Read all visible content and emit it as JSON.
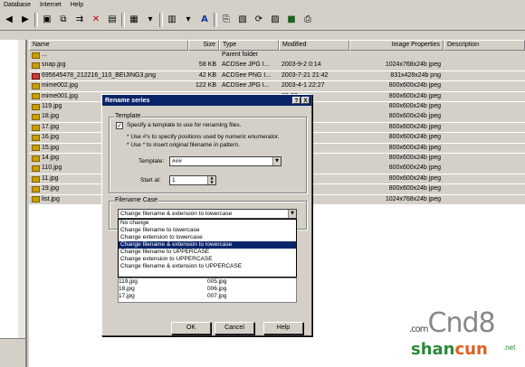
{
  "menu": [
    "Database",
    "Internet",
    "Help"
  ],
  "columns": [
    "Name",
    "Size",
    "Type",
    "Modified",
    "Image Properties",
    "Description"
  ],
  "files": [
    {
      "name": "...",
      "size": "",
      "type": "Parent folder",
      "modified": "",
      "props": "",
      "icon": "folder"
    },
    {
      "name": "snap.jpg",
      "size": "58 KB",
      "type": "ACDSee JPG I...",
      "modified": "2003-9-2 0:14",
      "props": "1024x768x24b jpeg",
      "icon": "jpg"
    },
    {
      "name": "695645478_212216_110_BEIJING3.png",
      "size": "42 KB",
      "type": "ACDSee PNG I...",
      "modified": "2003-7-21 21:42",
      "props": "831x428x24b png",
      "icon": "png"
    },
    {
      "name": "mime002.jpg",
      "size": "122 KB",
      "type": "ACDSee JPG I...",
      "modified": "2003-4-1 22:27",
      "props": "800x600x24b jpeg",
      "icon": "jpg"
    },
    {
      "name": "mime001.jpg",
      "size": "",
      "type": "",
      "modified": "22:27",
      "props": "800x600x24b jpeg",
      "icon": "jpg"
    },
    {
      "name": "119.jpg",
      "size": "",
      "type": "",
      "modified": "2:27",
      "props": "800x600x24b jpeg",
      "icon": "jpg"
    },
    {
      "name": "18.jpg",
      "size": "",
      "type": "",
      "modified": "2:27",
      "props": "800x600x24b jpeg",
      "icon": "jpg"
    },
    {
      "name": "17.jpg",
      "size": "",
      "type": "",
      "modified": "2:27",
      "props": "800x600x24b jpeg",
      "icon": "jpg"
    },
    {
      "name": "16.jpg",
      "size": "",
      "type": "",
      "modified": "2:27",
      "props": "800x600x24b jpeg",
      "icon": "jpg"
    },
    {
      "name": "15.jpg",
      "size": "",
      "type": "",
      "modified": "2:27",
      "props": "800x600x24b jpeg",
      "icon": "jpg"
    },
    {
      "name": "14.jpg",
      "size": "",
      "type": "",
      "modified": "2:27",
      "props": "800x600x24b jpeg",
      "icon": "jpg"
    },
    {
      "name": "110.jpg",
      "size": "",
      "type": "",
      "modified": "2:27",
      "props": "800x600x24b jpeg",
      "icon": "jpg"
    },
    {
      "name": "11.jpg",
      "size": "",
      "type": "",
      "modified": "2:27",
      "props": "800x600x24b jpeg",
      "icon": "jpg"
    },
    {
      "name": "19.jpg",
      "size": "",
      "type": "",
      "modified": "2:27",
      "props": "800x600x24b jpeg",
      "icon": "jpg"
    },
    {
      "name": "list.jpg",
      "size": "",
      "type": "",
      "modified": "16",
      "props": "1024x768x24b jpeg",
      "icon": "jpg"
    }
  ],
  "dialog": {
    "title": "Rename series",
    "help_btn": "?",
    "close_btn": "X",
    "template_group": "Template",
    "specify_label": "Specify a template to use for renaming files.",
    "hint1": "* Use #'s to specify positions used by numeric enumerator.",
    "hint2": "* Use * to insert original filename in pattern.",
    "template_label": "Template:",
    "template_value": "###",
    "start_label": "Start at:",
    "start_value": "1",
    "case_group": "Filename Case",
    "case_value": "Change filename & extension to lowercase",
    "case_options": [
      "No change",
      "Change filename to lowercase",
      "Change extension to lowercase",
      "Change filename & extension to lowercase",
      "Change filename to UPPERCASE",
      "Change extension to UPPERCASE",
      "Change filename & extension to UPPERCASE"
    ],
    "selected_option_index": 3,
    "preview": [
      [
        "119.jpg",
        "005.jpg"
      ],
      [
        "18.jpg",
        "006.jpg"
      ],
      [
        "17.jpg",
        "007.jpg"
      ]
    ],
    "ok": "OK",
    "cancel": "Cancel",
    "help": "Help"
  },
  "watermark": {
    "com": ".com",
    "brand": "Cnd8",
    "site_a": "shan",
    "site_b": "cun",
    "site_c": ".net"
  }
}
